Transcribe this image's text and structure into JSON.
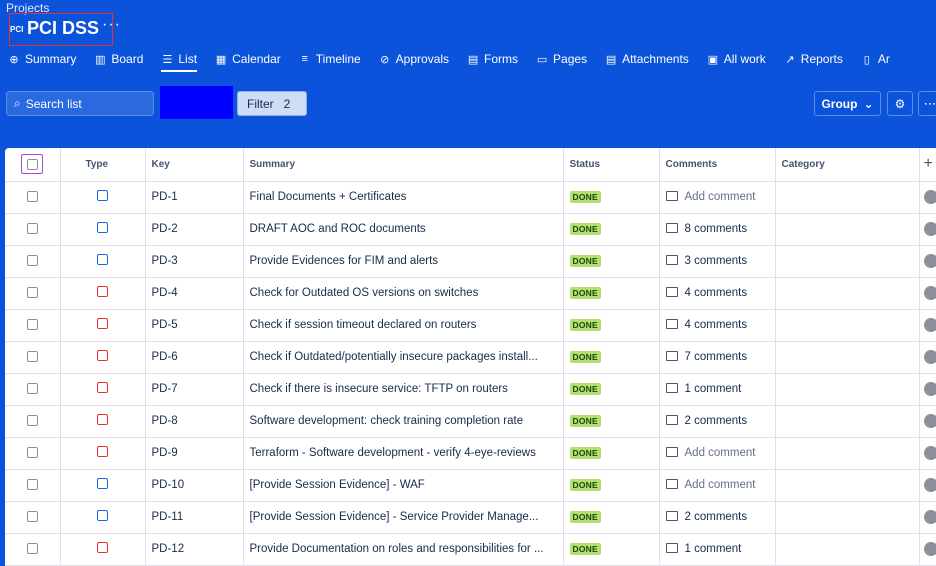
{
  "breadcrumb": "Projects",
  "project": {
    "title": "PCI DSS",
    "icon_label": "PCI",
    "more": "···"
  },
  "tabs": [
    {
      "label": "Summary",
      "icon": "globe-icon",
      "glyph": "⊕",
      "active": false
    },
    {
      "label": "Board",
      "icon": "board-icon",
      "glyph": "▥",
      "active": false
    },
    {
      "label": "List",
      "icon": "list-icon",
      "glyph": "☰",
      "active": true
    },
    {
      "label": "Calendar",
      "icon": "calendar-icon",
      "glyph": "▦",
      "active": false
    },
    {
      "label": "Timeline",
      "icon": "timeline-icon",
      "glyph": "≡",
      "active": false
    },
    {
      "label": "Approvals",
      "icon": "approvals-icon",
      "glyph": "⊘",
      "active": false
    },
    {
      "label": "Forms",
      "icon": "forms-icon",
      "glyph": "▤",
      "active": false
    },
    {
      "label": "Pages",
      "icon": "pages-icon",
      "glyph": "▭",
      "active": false
    },
    {
      "label": "Attachments",
      "icon": "attachments-icon",
      "glyph": "▤",
      "active": false
    },
    {
      "label": "All work",
      "icon": "all-work-icon",
      "glyph": "▣",
      "active": false
    },
    {
      "label": "Reports",
      "icon": "reports-icon",
      "glyph": "↗",
      "active": false
    },
    {
      "label": "Ar",
      "icon": "archive-icon",
      "glyph": "▯",
      "active": false
    }
  ],
  "toolbar": {
    "search_label": "Search list",
    "filter_label": "Filter",
    "filter_count": "2",
    "group_label": "Group",
    "group_chevron": "⌄",
    "settings_glyph": "⚙",
    "more_glyph": "⋯"
  },
  "columns": {
    "type": "Type",
    "key": "Key",
    "summary": "Summary",
    "status": "Status",
    "comments": "Comments",
    "category": "Category",
    "add": "+"
  },
  "colors": {
    "banner": "#0b53da",
    "done": "#b3df72",
    "task": "#1868db",
    "bug": "#e2342b"
  },
  "rows": [
    {
      "type": "task",
      "key": "PD-1",
      "summary": "Final Documents + Certificates",
      "status": "DONE",
      "comments": "Add comment",
      "has_comments": false
    },
    {
      "type": "task",
      "key": "PD-2",
      "summary": "DRAFT AOC and ROC documents",
      "status": "DONE",
      "comments": "8 comments",
      "has_comments": true
    },
    {
      "type": "task",
      "key": "PD-3",
      "summary": "Provide Evidences for FIM and alerts",
      "status": "DONE",
      "comments": "3 comments",
      "has_comments": true
    },
    {
      "type": "bug",
      "key": "PD-4",
      "summary": "Check for Outdated OS versions on switches",
      "status": "DONE",
      "comments": "4 comments",
      "has_comments": true
    },
    {
      "type": "bug",
      "key": "PD-5",
      "summary": "Check if session timeout declared on routers",
      "status": "DONE",
      "comments": "4 comments",
      "has_comments": true
    },
    {
      "type": "bug",
      "key": "PD-6",
      "summary": "Check if Outdated/potentially insecure packages install...",
      "status": "DONE",
      "comments": "7 comments",
      "has_comments": true
    },
    {
      "type": "bug",
      "key": "PD-7",
      "summary": "Check if there is insecure service: TFTP on routers",
      "status": "DONE",
      "comments": "1 comment",
      "has_comments": true
    },
    {
      "type": "bug",
      "key": "PD-8",
      "summary": "Software development: check training completion rate",
      "status": "DONE",
      "comments": "2 comments",
      "has_comments": true
    },
    {
      "type": "bug",
      "key": "PD-9",
      "summary": "Terraform - Software development - verify 4-eye-reviews",
      "status": "DONE",
      "comments": "Add comment",
      "has_comments": false
    },
    {
      "type": "task",
      "key": "PD-10",
      "summary": "[Provide Session Evidence] - WAF",
      "status": "DONE",
      "comments": "Add comment",
      "has_comments": false
    },
    {
      "type": "task",
      "key": "PD-11",
      "summary": "[Provide Session Evidence] - Service Provider Manage...",
      "status": "DONE",
      "comments": "2 comments",
      "has_comments": true
    },
    {
      "type": "bug",
      "key": "PD-12",
      "summary": "Provide Documentation on roles and responsibilities for ...",
      "status": "DONE",
      "comments": "1 comment",
      "has_comments": true
    }
  ]
}
